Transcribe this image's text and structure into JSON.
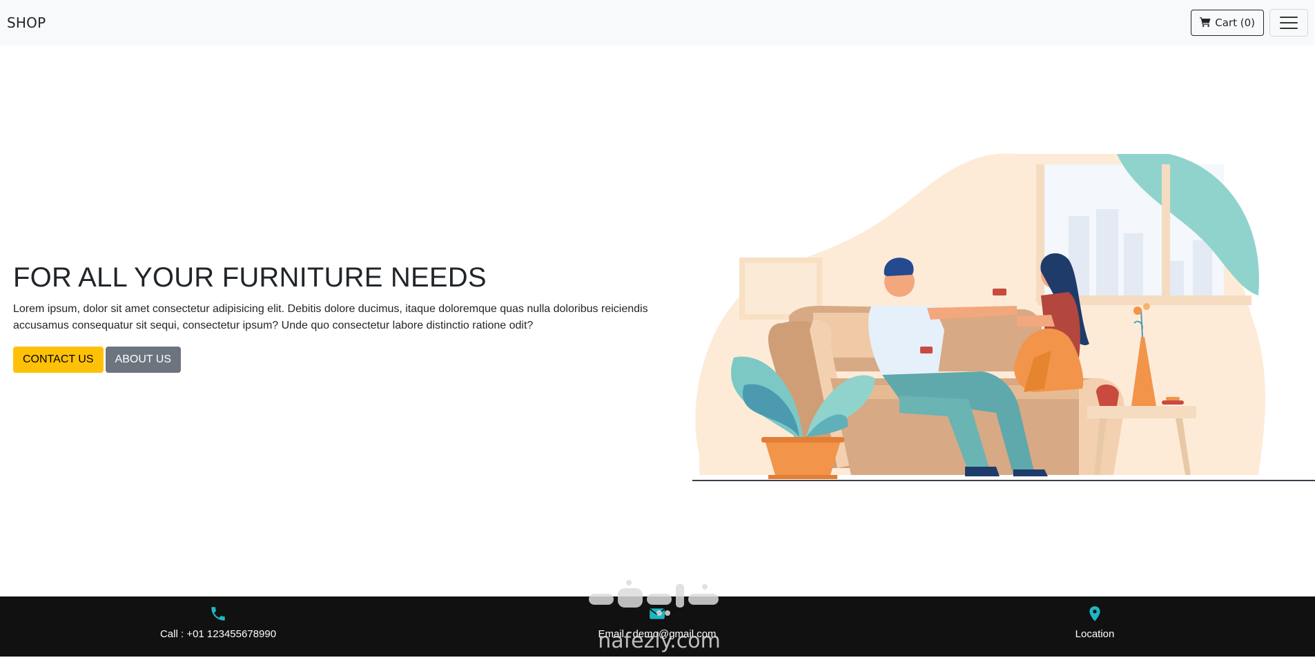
{
  "navbar": {
    "brand": "SHOP",
    "cart_label": "Cart (0)",
    "cart_icon": "shopping-cart-icon",
    "menu_icon": "hamburger-menu-icon"
  },
  "hero": {
    "title": "FOR ALL YOUR FURNITURE NEEDS",
    "description": "Lorem ipsum, dolor sit amet consectetur adipisicing elit. Debitis dolore ducimus, itaque doloremque quas nulla doloribus reiciendis accusamus consequatur sit sequi, consectetur ipsum? Unde quo consectetur labore distinctio ratione odit?",
    "buttons": [
      {
        "label": "CONTACT US",
        "color": "#ffc107"
      },
      {
        "label": "ABOUT US",
        "color": "#6c757d"
      }
    ]
  },
  "footer": {
    "items": [
      {
        "icon": "phone-icon",
        "label": "Call : +01 123455678990"
      },
      {
        "icon": "envelope-icon",
        "label": "Email : demo@gmail.com"
      },
      {
        "icon": "map-marker-icon",
        "label": "Location"
      }
    ],
    "icon_color": "#1fb6c4",
    "background": "#111111"
  },
  "watermark": {
    "text": "nafezly.com"
  }
}
